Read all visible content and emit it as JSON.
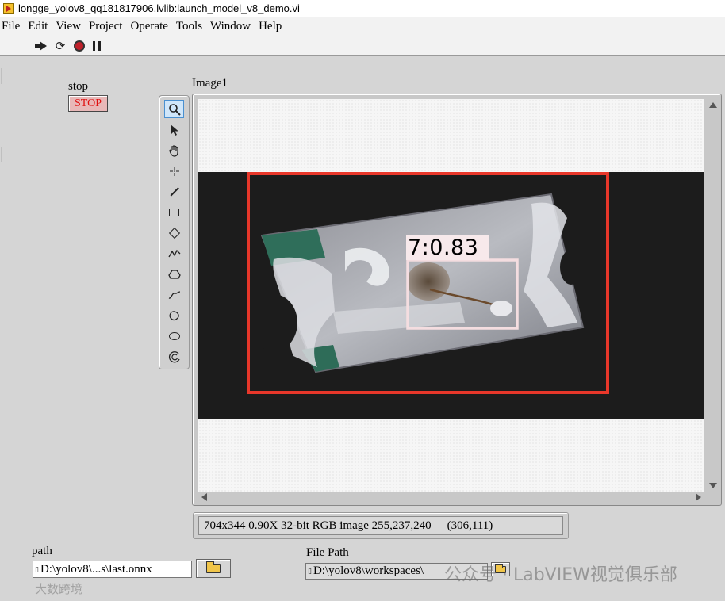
{
  "window": {
    "title": "longge_yolov8_qq181817906.lvlib:launch_model_v8_demo.vi"
  },
  "menu": [
    "File",
    "Edit",
    "View",
    "Project",
    "Operate",
    "Tools",
    "Window",
    "Help"
  ],
  "toolbar": {
    "icons": [
      "run-arrow-icon",
      "run-continuously-icon",
      "abort-icon",
      "pause-icon"
    ]
  },
  "stop_control": {
    "label": "stop",
    "button_text": "STOP",
    "text_color": "#e01010"
  },
  "image_display": {
    "label": "Image1",
    "tools": [
      "zoom-icon",
      "pointer-icon",
      "pan-hand-icon",
      "point-icon",
      "line-icon",
      "rectangle-icon",
      "rotated-rectangle-icon",
      "polyline-icon",
      "polygon-icon",
      "freehand-line-icon",
      "freehand-region-icon",
      "oval-icon",
      "annulus-icon"
    ],
    "detection": {
      "label": "7:0.83",
      "outer_box_color": "#e8372a",
      "inner_box_color": "#f4dde0"
    },
    "status": "704x344 0.90X 32-bit RGB image 255,237,240",
    "coords": "(306,111)"
  },
  "path_control": {
    "label": "path",
    "value": "D:\\yolov8\\...s\\last.onnx"
  },
  "file_path_control": {
    "label": "File Path",
    "value": "D:\\yolov8\\workspaces\\"
  },
  "watermarks": {
    "left": "大数跨境",
    "right": "公众号 · LabVIEW视觉俱乐部"
  }
}
